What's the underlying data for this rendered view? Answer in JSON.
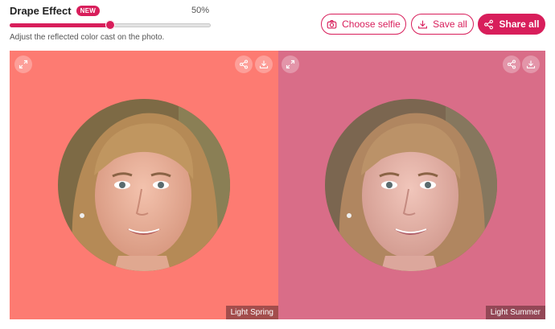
{
  "drape": {
    "title": "Drape Effect",
    "badge": "NEW",
    "value_label": "50%",
    "value": 0.5,
    "hint": "Adjust the reflected color cast on the photo."
  },
  "toolbar": {
    "choose_selfie_label": "Choose selfie",
    "save_all_label": "Save all",
    "share_all_label": "Share all"
  },
  "panels": [
    {
      "label": "Light Spring",
      "color": "#fd7b72"
    },
    {
      "label": "Light Summer",
      "color": "#d96d88"
    }
  ],
  "colors": {
    "accent": "#d81e5b"
  }
}
